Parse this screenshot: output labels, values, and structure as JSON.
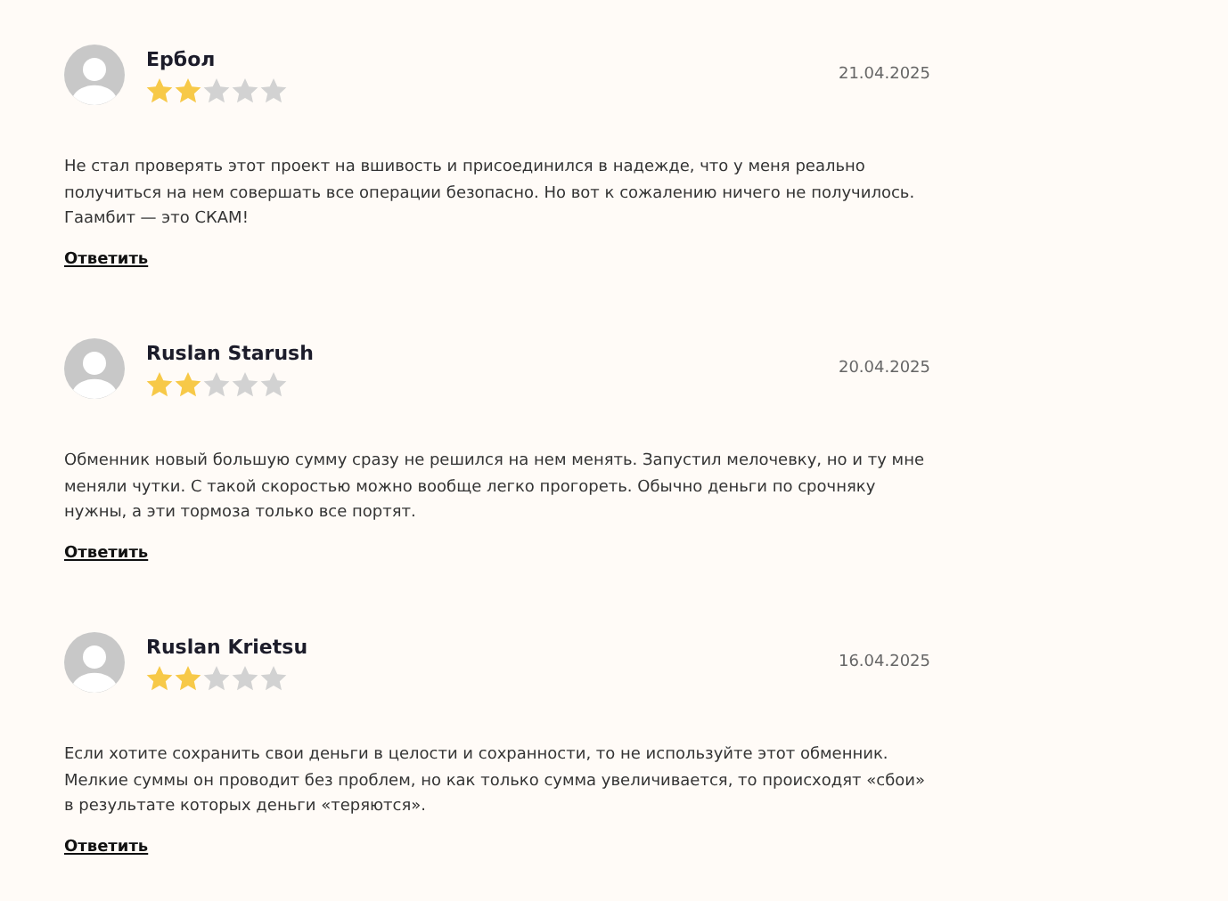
{
  "reviews": [
    {
      "name": "Ербол",
      "stars": 2,
      "date": "21.04.2025",
      "text": "Не стал проверять этот проект на вшивость и присоединился в надежде, что у меня реально получиться на нем совершать все операции безопасно. Но вот к сожалению ничего не получилось. Гаамбит — это СКАМ!",
      "reply": "Ответить"
    },
    {
      "name": "Ruslan Starush",
      "stars": 2,
      "date": "20.04.2025",
      "text": "Обменник новый большую сумму сразу не решился на нем менять. Запустил мелочевку, но и ту мне меняли чутки. С такой скоростью можно вообще легко прогореть. Обычно деньги по срочняку нужны, а эти тормоза только все портят.",
      "reply": "Ответить"
    },
    {
      "name": "Ruslan Krietsu",
      "stars": 2,
      "date": "16.04.2025",
      "text": "Если хотите сохранить свои деньги в целости и сохранности, то не используйте этот обменник. Мелкие суммы он проводит без проблем, но как только сумма увеличивается, то происходят «сбои» в результате которых деньги «теряются».",
      "reply": "Ответить"
    }
  ]
}
